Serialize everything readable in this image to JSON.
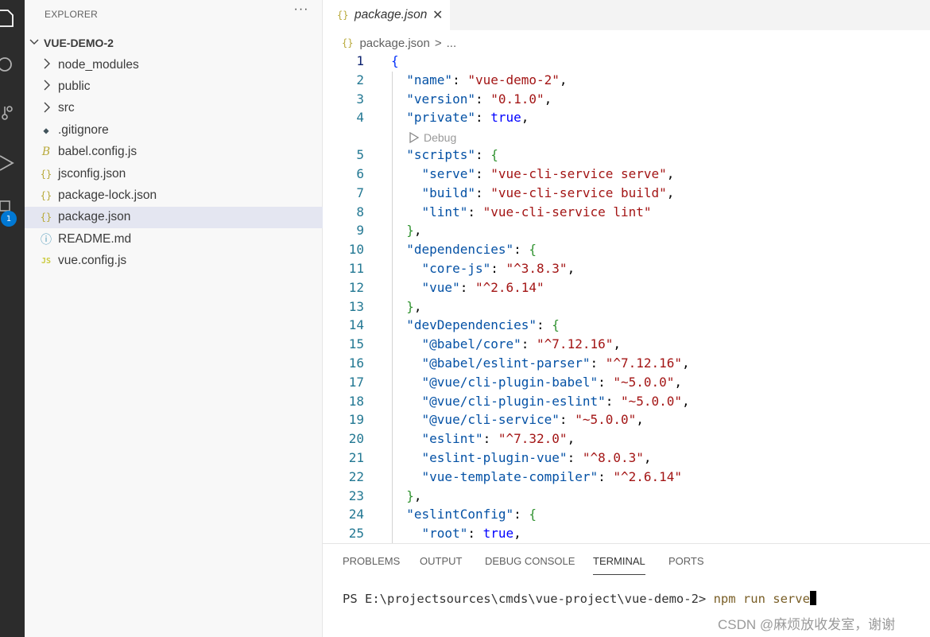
{
  "sidebar": {
    "title": "EXPLORER",
    "more": "···",
    "folder": "VUE-DEMO-2",
    "items": [
      {
        "label": "node_modules",
        "kind": "folder"
      },
      {
        "label": "public",
        "kind": "folder"
      },
      {
        "label": "src",
        "kind": "folder"
      },
      {
        "label": ".gitignore",
        "icon": "git-icon"
      },
      {
        "label": "babel.config.js",
        "icon": "babel-icon"
      },
      {
        "label": "jsconfig.json",
        "icon": "json-icon"
      },
      {
        "label": "package-lock.json",
        "icon": "json-icon"
      },
      {
        "label": "package.json",
        "icon": "json-icon",
        "selected": true
      },
      {
        "label": "README.md",
        "icon": "info-icon"
      },
      {
        "label": "vue.config.js",
        "icon": "js-icon"
      }
    ],
    "json_glyph": "{}",
    "js_glyph": "JS",
    "info_glyph": "ⓘ",
    "babel_glyph": "B",
    "git_glyph": "◆"
  },
  "activity": {
    "badge": "1"
  },
  "editor": {
    "tab": {
      "label": "package.json",
      "close": "✕"
    },
    "breadcrumb": {
      "file": "package.json",
      "sep": ">",
      "more": "..."
    },
    "codelens": "Debug",
    "lines": [
      {
        "n": "1",
        "text": "{"
      },
      {
        "n": "2",
        "text": "  \"name\": \"vue-demo-2\","
      },
      {
        "n": "3",
        "text": "  \"version\": \"0.1.0\","
      },
      {
        "n": "4",
        "text": "  \"private\": true,"
      },
      {
        "n": "5",
        "text": "  \"scripts\": {"
      },
      {
        "n": "6",
        "text": "    \"serve\": \"vue-cli-service serve\","
      },
      {
        "n": "7",
        "text": "    \"build\": \"vue-cli-service build\","
      },
      {
        "n": "8",
        "text": "    \"lint\": \"vue-cli-service lint\""
      },
      {
        "n": "9",
        "text": "  },"
      },
      {
        "n": "10",
        "text": "  \"dependencies\": {"
      },
      {
        "n": "11",
        "text": "    \"core-js\": \"^3.8.3\","
      },
      {
        "n": "12",
        "text": "    \"vue\": \"^2.6.14\""
      },
      {
        "n": "13",
        "text": "  },"
      },
      {
        "n": "14",
        "text": "  \"devDependencies\": {"
      },
      {
        "n": "15",
        "text": "    \"@babel/core\": \"^7.12.16\","
      },
      {
        "n": "16",
        "text": "    \"@babel/eslint-parser\": \"^7.12.16\","
      },
      {
        "n": "17",
        "text": "    \"@vue/cli-plugin-babel\": \"~5.0.0\","
      },
      {
        "n": "18",
        "text": "    \"@vue/cli-plugin-eslint\": \"~5.0.0\","
      },
      {
        "n": "19",
        "text": "    \"@vue/cli-service\": \"~5.0.0\","
      },
      {
        "n": "20",
        "text": "    \"eslint\": \"^7.32.0\","
      },
      {
        "n": "21",
        "text": "    \"eslint-plugin-vue\": \"^8.0.3\","
      },
      {
        "n": "22",
        "text": "    \"vue-template-compiler\": \"^2.6.14\""
      },
      {
        "n": "23",
        "text": "  },"
      },
      {
        "n": "24",
        "text": "  \"eslintConfig\": {"
      },
      {
        "n": "25",
        "text": "    \"root\": true,"
      }
    ]
  },
  "panel": {
    "tabs": [
      "PROBLEMS",
      "OUTPUT",
      "DEBUG CONSOLE",
      "TERMINAL",
      "PORTS"
    ],
    "active_tab": "TERMINAL",
    "terminal": {
      "prompt": "PS E:\\projectsources\\cmds\\vue-project\\vue-demo-2> ",
      "command": "npm run serve"
    }
  },
  "watermark": "CSDN @麻烦放收发室，谢谢",
  "colors": {
    "accent": "#0078d4",
    "json_icon": "#b8a93a",
    "js_icon": "#cbcb41",
    "info_icon": "#519aba",
    "git_icon": "#41535b"
  }
}
